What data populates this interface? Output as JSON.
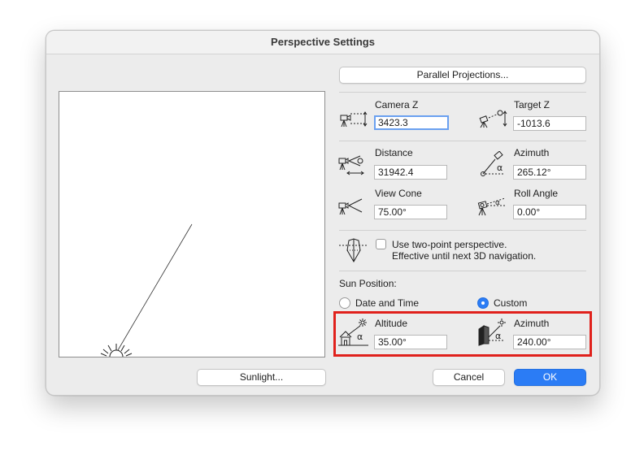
{
  "window": {
    "title": "Perspective Settings"
  },
  "buttons": {
    "parallel_projections": "Parallel Projections...",
    "sunlight": "Sunlight...",
    "cancel": "Cancel",
    "ok": "OK"
  },
  "camera": {
    "camera_z_label": "Camera Z",
    "camera_z_value": "3423.3",
    "target_z_label": "Target Z",
    "target_z_value": "-1013.6",
    "distance_label": "Distance",
    "distance_value": "31942.4",
    "azimuth_label": "Azimuth",
    "azimuth_value": "265.12°",
    "view_cone_label": "View Cone",
    "view_cone_value": "75.00°",
    "roll_angle_label": "Roll Angle",
    "roll_angle_value": "0.00°"
  },
  "two_point": {
    "line1": "Use two-point perspective.",
    "line2": "Effective until next 3D navigation.",
    "checked": false
  },
  "sun": {
    "section_label": "Sun Position:",
    "date_time_label": "Date and Time",
    "custom_label": "Custom",
    "selected": "Custom",
    "altitude_label": "Altitude",
    "altitude_value": "35.00°",
    "azimuth_label": "Azimuth",
    "azimuth_value": "240.00°"
  },
  "colors": {
    "accent": "#2b7cf5",
    "highlight": "#e0211c"
  }
}
